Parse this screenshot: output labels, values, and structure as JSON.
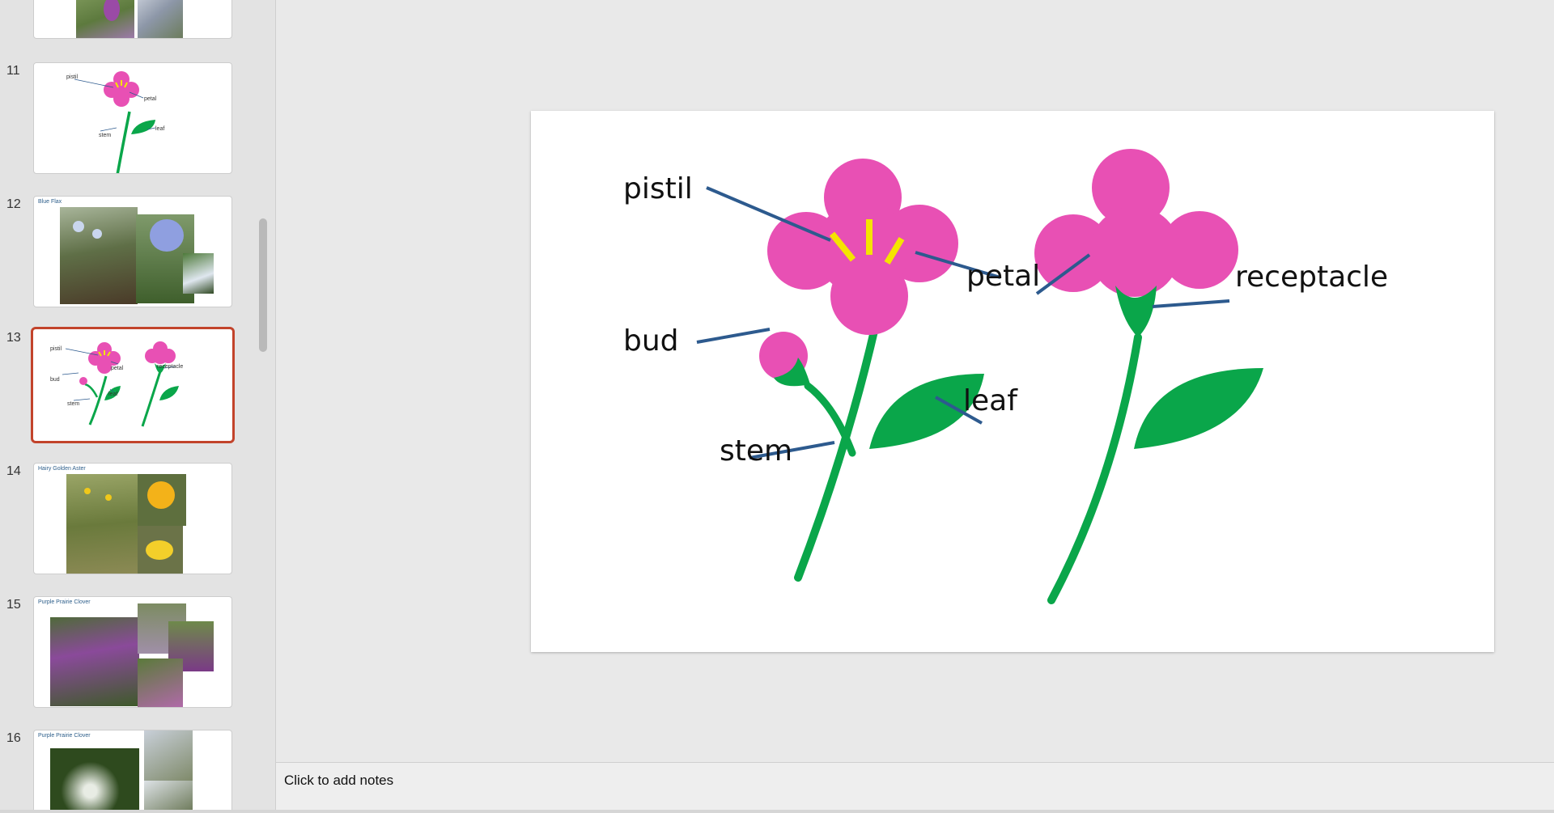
{
  "thumbnails": [
    {
      "number": "",
      "title": ""
    },
    {
      "number": "11",
      "title": ""
    },
    {
      "number": "12",
      "title": "Blue Flax"
    },
    {
      "number": "13",
      "title": ""
    },
    {
      "number": "14",
      "title": "Hairy Golden Aster"
    },
    {
      "number": "15",
      "title": "Purple Prairie Clover"
    },
    {
      "number": "16",
      "title": "Purple Prairie Clover"
    }
  ],
  "selected_slide": "13",
  "slide": {
    "labels": {
      "pistil": "pistil",
      "petal": "petal",
      "receptacle": "receptacle",
      "bud": "bud",
      "leaf": "leaf",
      "stem": "stem"
    }
  },
  "notes": {
    "placeholder": "Click to add notes"
  },
  "colors": {
    "petal": "#e850b4",
    "pistil": "#f5e400",
    "green": "#0aa64a",
    "pointer": "#2d5a8e",
    "selection": "#c2432b"
  }
}
